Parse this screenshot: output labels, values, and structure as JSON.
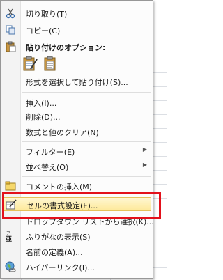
{
  "context_menu": {
    "cut": "切り取り(T)",
    "copy": "コピー(C)",
    "paste_options_header": "貼り付けのオプション:",
    "paste_special": "形式を選択して貼り付け(S)...",
    "insert": "挿入(I)...",
    "delete": "削除(D)...",
    "clear_contents": "数式と値のクリア(N)",
    "filter": "フィルター(E)",
    "sort": "並べ替え(O)",
    "insert_comment": "コメントの挿入(M)",
    "format_cells": "セルの書式設定(F)...",
    "pick_from_list": "ドロップダウン リストから選択(K)...",
    "phonetic": "ふりがなの表示(S)",
    "define_name": "名前の定義(A)...",
    "hyperlink": "ハイパーリンク(I)..."
  },
  "icons": {
    "cut": "scissors-icon",
    "copy": "copy-icon",
    "paste_header": "clipboard-icon",
    "paste_formatting": "paste-brush-icon",
    "paste_values": "paste-values-icon",
    "insert_comment": "comment-icon",
    "format_cells": "format-cells-icon",
    "phonetic": "phonetic-icon",
    "hyperlink": "globe-link-icon"
  },
  "colors": {
    "highlight_border": "#e3111b",
    "hover_fill": "#fde99a"
  }
}
